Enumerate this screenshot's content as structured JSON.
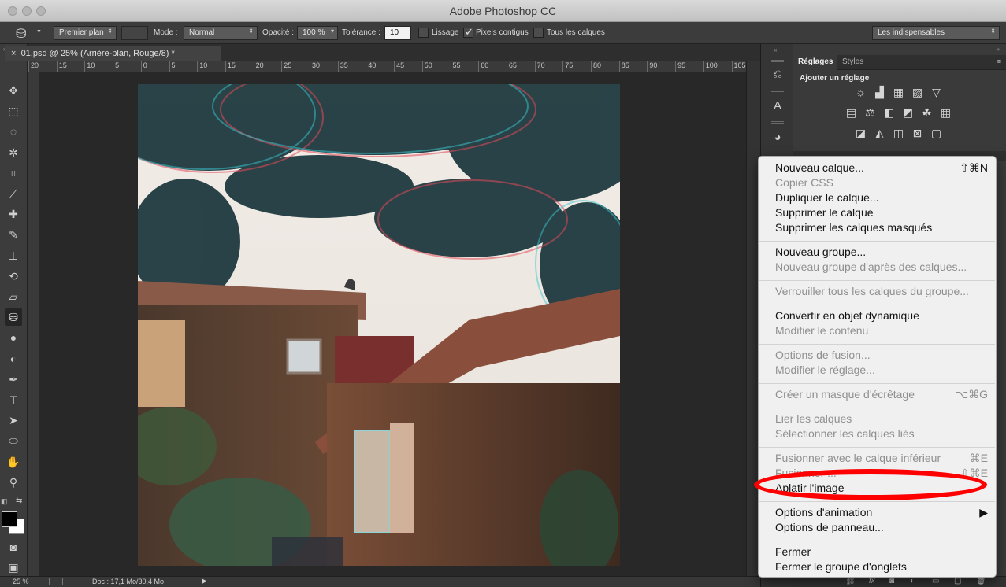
{
  "window": {
    "title": "Adobe Photoshop CC"
  },
  "options_bar": {
    "fill_source": "Premier plan",
    "mode_label": "Mode :",
    "mode_value": "Normal",
    "opacity_label": "Opacité :",
    "opacity_value": "100 %",
    "tolerance_label": "Tolérance :",
    "tolerance_value": "10",
    "antialias_label": "Lissage",
    "antialias_checked": false,
    "contiguous_label": "Pixels contigus",
    "contiguous_checked": true,
    "all_layers_label": "Tous les calques",
    "all_layers_checked": false,
    "workspace": "Les indispensables"
  },
  "document": {
    "close_glyph": "×",
    "tab_title": "01.psd @ 25% (Arrière-plan, Rouge/8) *",
    "status_zoom": "25 %",
    "status_doc": "Doc : 17,1 Mo/30,4 Mo"
  },
  "ruler": {
    "h_ticks": [
      "20",
      "15",
      "10",
      "5",
      "0",
      "5",
      "10",
      "15",
      "20",
      "25",
      "30",
      "35",
      "40",
      "45",
      "50",
      "55",
      "60",
      "65",
      "70",
      "75",
      "80",
      "85",
      "90",
      "95",
      "100",
      "105"
    ]
  },
  "tools": [
    {
      "name": "move-tool",
      "glyph": "✥"
    },
    {
      "name": "marquee-tool",
      "glyph": "⬚"
    },
    {
      "name": "lasso-tool",
      "glyph": "◌"
    },
    {
      "name": "magic-wand-tool",
      "glyph": "✲"
    },
    {
      "name": "crop-tool",
      "glyph": "⌗"
    },
    {
      "name": "eyedropper-tool",
      "glyph": "⟋"
    },
    {
      "name": "healing-brush-tool",
      "glyph": "✚"
    },
    {
      "name": "brush-tool",
      "glyph": "✎"
    },
    {
      "name": "clone-stamp-tool",
      "glyph": "⊥"
    },
    {
      "name": "history-brush-tool",
      "glyph": "⟲"
    },
    {
      "name": "eraser-tool",
      "glyph": "▱"
    },
    {
      "name": "paint-bucket-tool",
      "glyph": "⛁"
    },
    {
      "name": "blur-tool",
      "glyph": "●"
    },
    {
      "name": "dodge-tool",
      "glyph": "◐"
    },
    {
      "name": "pen-tool",
      "glyph": "✒"
    },
    {
      "name": "type-tool",
      "glyph": "T"
    },
    {
      "name": "path-selection-tool",
      "glyph": "➤"
    },
    {
      "name": "ellipse-tool",
      "glyph": "⬭"
    },
    {
      "name": "hand-tool",
      "glyph": "✋"
    },
    {
      "name": "zoom-tool",
      "glyph": "⚲"
    }
  ],
  "right_panel": {
    "tab_adjustments": "Réglages",
    "tab_styles": "Styles",
    "add_adjustment": "Ajouter un réglage",
    "adj_row1": [
      "☼",
      "▟",
      "▦",
      "▨",
      "▽"
    ],
    "adj_row2": [
      "▤",
      "⚖",
      "◧",
      "◩",
      "☘",
      "▦"
    ],
    "adj_row3": [
      "◪",
      "◭",
      "◫",
      "⊠",
      "▢"
    ]
  },
  "context_menu": {
    "items": [
      {
        "label": "Nouveau calque...",
        "shortcut": "⇧⌘N",
        "enabled": true
      },
      {
        "label": "Copier CSS",
        "shortcut": "",
        "enabled": false
      },
      {
        "label": "Dupliquer le calque...",
        "shortcut": "",
        "enabled": true
      },
      {
        "label": "Supprimer le calque",
        "shortcut": "",
        "enabled": true
      },
      {
        "label": "Supprimer les calques masqués",
        "shortcut": "",
        "enabled": true
      },
      {
        "label": "Nouveau groupe...",
        "shortcut": "",
        "enabled": true
      },
      {
        "label": "Nouveau groupe d'après des calques...",
        "shortcut": "",
        "enabled": false
      },
      {
        "label": "Verrouiller tous les calques du groupe...",
        "shortcut": "",
        "enabled": false
      },
      {
        "label": "Convertir en objet dynamique",
        "shortcut": "",
        "enabled": true
      },
      {
        "label": "Modifier le contenu",
        "shortcut": "",
        "enabled": false
      },
      {
        "label": "Options de fusion...",
        "shortcut": "",
        "enabled": false
      },
      {
        "label": "Modifier le réglage...",
        "shortcut": "",
        "enabled": false
      },
      {
        "label": "Créer un masque d'écrêtage",
        "shortcut": "⌥⌘G",
        "enabled": false
      },
      {
        "label": "Lier les calques",
        "shortcut": "",
        "enabled": false
      },
      {
        "label": "Sélectionner les calques liés",
        "shortcut": "",
        "enabled": false
      },
      {
        "label": "Fusionner avec le calque inférieur",
        "shortcut": "⌘E",
        "enabled": false
      },
      {
        "label": "Fusionner ...",
        "shortcut": "⇧⌘E",
        "enabled": false
      },
      {
        "label": "Aplatir l'image",
        "shortcut": "",
        "enabled": true
      },
      {
        "label": "Options d'animation",
        "shortcut": "▶",
        "enabled": true
      },
      {
        "label": "Options de panneau...",
        "shortcut": "",
        "enabled": true
      },
      {
        "label": "Fermer",
        "shortcut": "",
        "enabled": true
      },
      {
        "label": "Fermer le groupe d'onglets",
        "shortcut": "",
        "enabled": true
      }
    ]
  }
}
